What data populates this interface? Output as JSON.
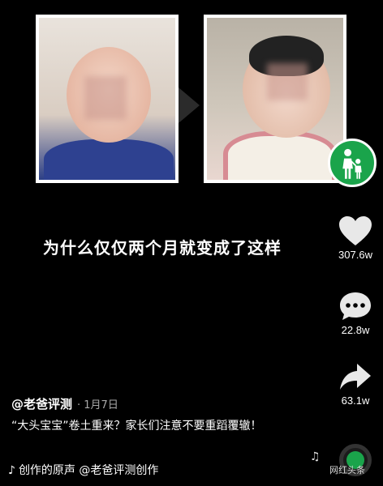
{
  "video": {
    "overlay_text": "为什么仅仅两个月就变成了这样"
  },
  "actions": {
    "like_count": "307.6w",
    "comment_count": "22.8w",
    "share_count": "63.1w"
  },
  "post": {
    "author": "@老爸评测",
    "date": "· 1月7日",
    "description": "“大头宝宝”卷土重来？家长们注意不要重蹈覆辙！",
    "music": "创作的原声 @老爸评测创作",
    "music_note": "♪"
  },
  "watermark": "网红头条",
  "colors": {
    "background": "#000000",
    "brand_green": "#1aa44b"
  }
}
